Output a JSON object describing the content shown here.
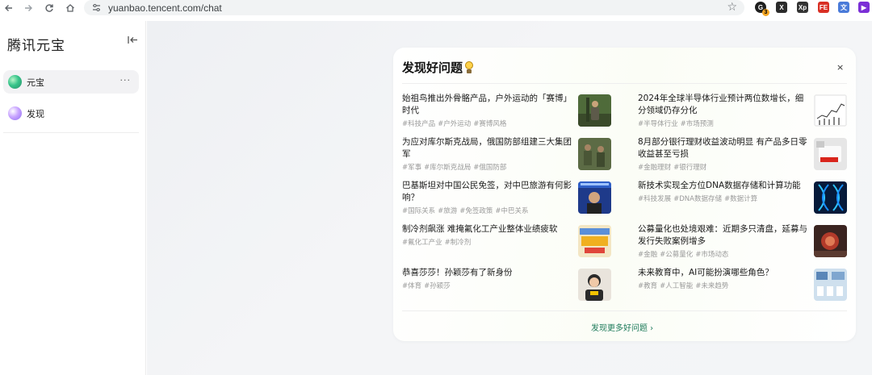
{
  "browser": {
    "url": "yuanbao.tencent.com/chat",
    "back_icon": "arrow-left",
    "forward_icon": "arrow-right",
    "reload_icon": "reload",
    "home_icon": "home",
    "ext_badge_count": "3"
  },
  "sidebar": {
    "brand": "腾讯元宝",
    "items": [
      {
        "label": "元宝",
        "active": true,
        "more": "···"
      },
      {
        "label": "发现",
        "active": false
      }
    ]
  },
  "card": {
    "title": "发现好问题",
    "close": "×",
    "more_link": "发现更多好问题 ›",
    "questions": [
      {
        "title": "始祖鸟推出外骨骼产品，户外运动的「赛博」时代",
        "tags": [
          "#科技产品",
          "#户外运动",
          "#赛博风格"
        ],
        "thumb": "outdoor"
      },
      {
        "title": "2024年全球半导体行业预计两位数增长，细分领域仍存分化",
        "tags": [
          "#半导体行业",
          "#市场预测"
        ],
        "thumb": "chart"
      },
      {
        "title": "为应对库尔斯克战局，俄国防部组建三大集团军",
        "tags": [
          "#军事",
          "#库尔斯克战局",
          "#俄国防部"
        ],
        "thumb": "soldiers"
      },
      {
        "title": "8月部分银行理财收益波动明显 有产品多日零收益甚至亏损",
        "tags": [
          "#金融理财",
          "#银行理财"
        ],
        "thumb": "finance"
      },
      {
        "title": "巴基斯坦对中国公民免签，对中巴旅游有何影响？",
        "tags": [
          "#国际关系",
          "#旅游",
          "#免签政策",
          "#中巴关系"
        ],
        "thumb": "pakistan"
      },
      {
        "title": "新技术实现全方位DNA数据存储和计算功能",
        "tags": [
          "#科技发展",
          "#DNA数据存储",
          "#数据计算"
        ],
        "thumb": "dna"
      },
      {
        "title": "制冷剂飙涨 难掩氟化工产业整体业绩疲软",
        "tags": [
          "#氟化工产业",
          "#制冷剂"
        ],
        "thumb": "refrigerant"
      },
      {
        "title": "公募量化也处境艰难：近期多只清盘，延募与发行失败案例增多",
        "tags": [
          "#金融",
          "#公募量化",
          "#市场动态"
        ],
        "thumb": "fund"
      },
      {
        "title": "恭喜莎莎！孙颖莎有了新身份",
        "tags": [
          "#体育",
          "#孙颖莎"
        ],
        "thumb": "athlete"
      },
      {
        "title": "未来教育中，AI可能扮演哪些角色？",
        "tags": [
          "#教育",
          "#人工智能",
          "#未来趋势"
        ],
        "thumb": "classroom"
      }
    ]
  },
  "colors": {
    "accent_green": "#1d7a5a",
    "tag_gray": "#9a9a9a"
  }
}
